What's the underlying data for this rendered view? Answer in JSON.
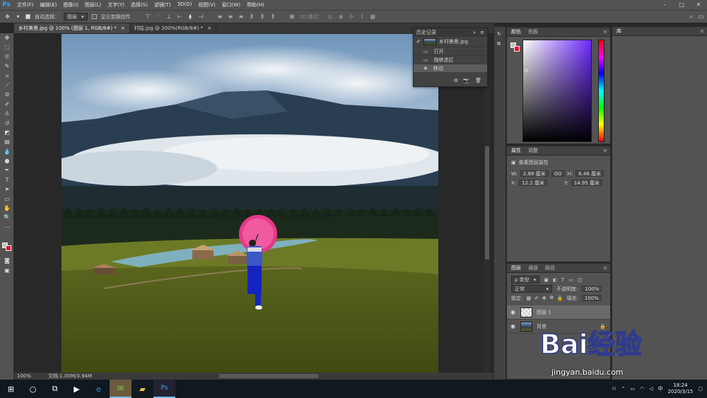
{
  "app": {
    "logo": "Ps"
  },
  "menu": [
    "文件(F)",
    "编辑(E)",
    "图像(I)",
    "图层(L)",
    "文字(Y)",
    "选择(S)",
    "滤镜(T)",
    "3D(D)",
    "视图(V)",
    "窗口(W)",
    "帮助(H)"
  ],
  "options": {
    "auto_select_label": "自动选择：",
    "auto_select_value": "图层",
    "show_transform_label": "显示变换控件",
    "mode_3d_label": "3D 模式："
  },
  "tabs": [
    {
      "label": "乡村美景.jpg @ 100% (图层 1, RGB/8#) *",
      "close": "×"
    },
    {
      "label": "村姑.jpg @ 200%(RGB/8#) *",
      "close": "×"
    }
  ],
  "status": {
    "zoom": "100%",
    "doc": "文档:1.00M/3.94M"
  },
  "history": {
    "title": "历史记录",
    "snapshot": "乡村美景.jpg",
    "steps": [
      "打开",
      "拖移选区",
      "移动"
    ],
    "active_index": 2
  },
  "color_panel": {
    "tabs": [
      "颜色",
      "色板"
    ],
    "fg": "#c3c3c3",
    "bg": "#e5132c"
  },
  "properties": {
    "tabs": [
      "属性",
      "调整"
    ],
    "title": "像素图层属性",
    "w_label": "W:",
    "w": "2.88 厘米",
    "h_label": "H:",
    "h": "6.46 厘米",
    "x_label": "X:",
    "x": "12.2 厘米",
    "y_label": "Y:",
    "y": "14.95 厘米",
    "link": "GO"
  },
  "layers": {
    "tabs": [
      "图层",
      "通道",
      "路径"
    ],
    "filter": "ρ 类型",
    "blend": "正常",
    "opacity_label": "不透明度:",
    "opacity": "100%",
    "lock_label": "锁定:",
    "fill_label": "填充:",
    "fill": "100%",
    "items": [
      {
        "name": "图层 1",
        "active": true
      },
      {
        "name": "背景",
        "active": false
      }
    ]
  },
  "library": {
    "title": "库"
  },
  "taskbar": {
    "time": "18:24",
    "date": "2020/3/15"
  },
  "watermark": {
    "text": "Bai经验",
    "url": "jingyan.baidu.com"
  }
}
